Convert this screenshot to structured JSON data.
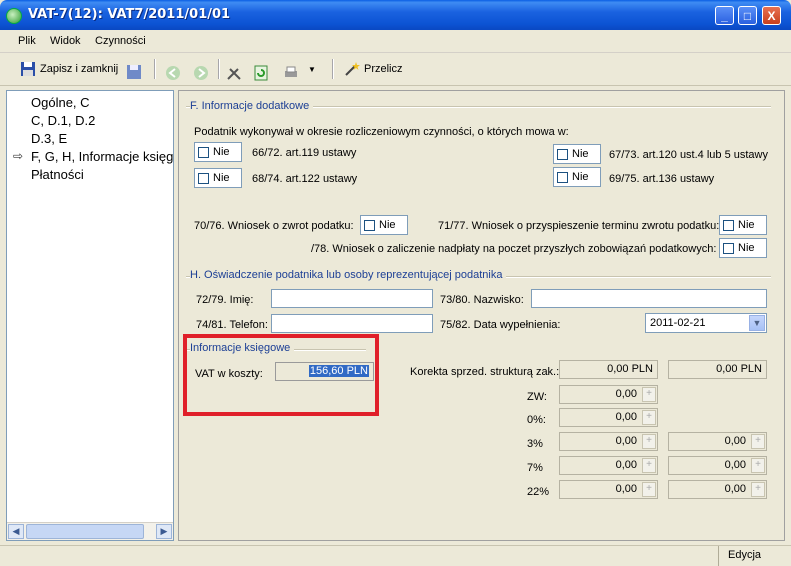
{
  "window": {
    "title": "VAT-7(12): VAT7/2011/01/01",
    "min": "_",
    "max": "□",
    "close": "X"
  },
  "menu": [
    "Plik",
    "Widok",
    "Czynności"
  ],
  "toolbar": {
    "save_close": "Zapisz i zamknij",
    "recalc": "Przelicz"
  },
  "tree": {
    "items": [
      "Ogólne, C",
      "C, D.1, D.2",
      "D.3, E",
      "F, G, H, Informacje księg",
      "Płatności"
    ],
    "selected_marker": "⇨"
  },
  "sectionF": {
    "title": "F. Informacje dodatkowe",
    "intro": "Podatnik wykonywał w okresie rozliczeniowym czynności, o których mowa w:",
    "items": [
      {
        "value": "Nie",
        "label": "66/72. art.119 ustawy"
      },
      {
        "value": "Nie",
        "label": "68/74. art.122 ustawy"
      },
      {
        "value": "Nie",
        "label": "67/73. art.120 ust.4 lub 5 ustawy"
      },
      {
        "value": "Nie",
        "label": "69/75. art.136 ustawy"
      }
    ],
    "refund_label": "70/76. Wniosek o zwrot podatku:",
    "refund_value": "Nie",
    "accel_label": "71/77. Wniosek o przyspieszenie terminu zwrotu podatku:",
    "accel_value": "Nie",
    "offset_label": "/78. Wniosek o zaliczenie nadpłaty na poczet przyszłych zobowiązań podatkowych:",
    "offset_value": "Nie"
  },
  "sectionH": {
    "title": "H. Oświadczenie podatnika lub osoby reprezentującej podatnika",
    "first_name_label": "72/79. Imię:",
    "first_name_value": "",
    "last_name_label": "73/80. Nazwisko:",
    "last_name_value": "",
    "phone_label": "74/81. Telefon:",
    "phone_value": "",
    "date_label": "75/82. Data wypełnienia:",
    "date_value": "2011-02-21"
  },
  "accounting": {
    "title": "Informacje księgowe",
    "vat_label": "VAT w koszty:",
    "vat_value": "156,60 PLN",
    "korekta_label": "Korekta sprzed. strukturą zak.:",
    "korekta_a": "0,00 PLN",
    "korekta_b": "0,00 PLN",
    "rows": [
      {
        "label": "ZW:",
        "a": "0,00"
      },
      {
        "label": "0%:",
        "a": "0,00"
      },
      {
        "label": "3%",
        "a": "0,00",
        "b": "0,00"
      },
      {
        "label": "7%",
        "a": "0,00",
        "b": "0,00"
      },
      {
        "label": "22%",
        "a": "0,00",
        "b": "0,00"
      }
    ]
  },
  "status": {
    "mode": "Edycja"
  },
  "colors": {
    "title_blue": "#0a5ee4",
    "group_title": "#1c3f95",
    "highlight_red": "#e0202a",
    "selection": "#316ac5"
  }
}
